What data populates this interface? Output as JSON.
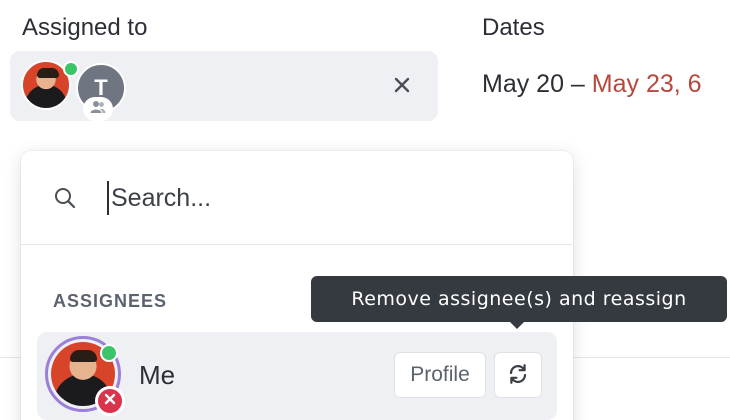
{
  "assigned": {
    "label": "Assigned to",
    "team_avatar_initial": "T",
    "clear_icon": "close-icon"
  },
  "dates": {
    "label": "Dates",
    "start": "May 20",
    "separator": " – ",
    "end": "May 23, 6"
  },
  "dropdown": {
    "search": {
      "placeholder": "Search...",
      "value": "",
      "icon": "search-icon"
    },
    "section_title": "ASSIGNEES",
    "assignees": [
      {
        "name": "Me",
        "online": true,
        "profile_label": "Profile",
        "reassign_icon": "refresh-icon",
        "remove_icon": "remove-icon"
      }
    ]
  },
  "tooltip": {
    "text": "Remove assignee(s) and reassign"
  },
  "colors": {
    "online": "#3cc46b",
    "remove": "#d9344b",
    "due_date": "#b7483d",
    "avatar_ring": "#9b7fd9",
    "tooltip_bg": "#353a41"
  }
}
